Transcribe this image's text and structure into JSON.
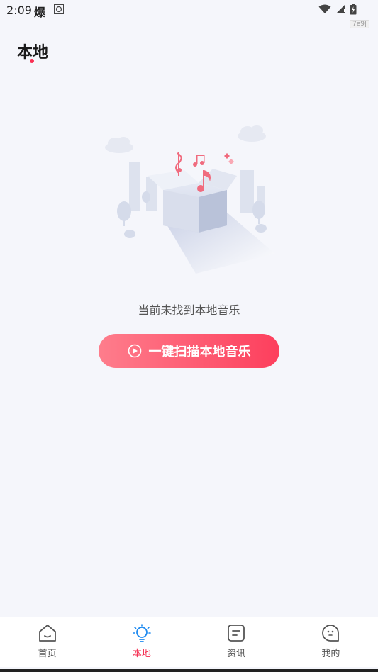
{
  "status_bar": {
    "time": "2:09",
    "app_char": "爆",
    "tag": "7e9|"
  },
  "page": {
    "title": "本地"
  },
  "empty_state": {
    "message": "当前未找到本地音乐",
    "scan_button_label": "一键扫描本地音乐"
  },
  "bottom_nav": {
    "items": [
      {
        "label": "首页",
        "icon": "home-icon"
      },
      {
        "label": "本地",
        "icon": "bulb-icon"
      },
      {
        "label": "资讯",
        "icon": "news-icon"
      },
      {
        "label": "我的",
        "icon": "profile-icon"
      }
    ],
    "active": "本地"
  },
  "colors": {
    "accent": "#f4264a",
    "button_start": "#fe7d8c",
    "button_end": "#fd3f5d",
    "background": "#f5f6fb"
  }
}
